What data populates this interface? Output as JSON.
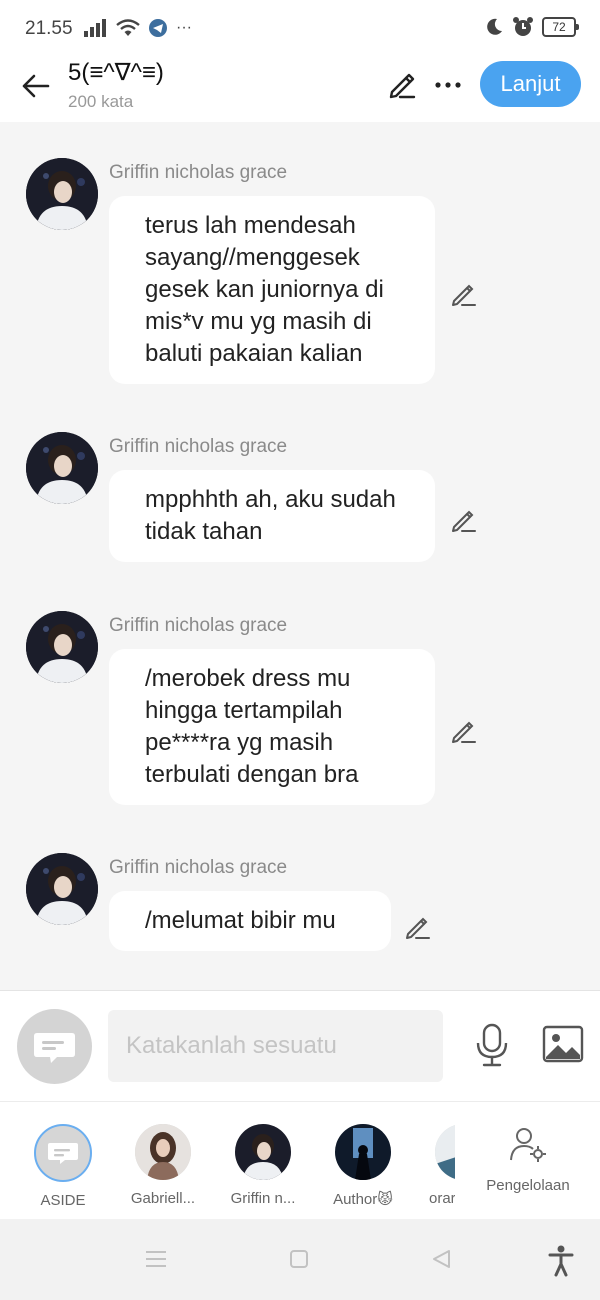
{
  "status_bar": {
    "time": "21.55",
    "ellipsis": "···",
    "battery": "72"
  },
  "header": {
    "title": "5(≡^∇^≡)",
    "word_count": "200 kata",
    "next_button": "Lanjut"
  },
  "messages": [
    {
      "sender": "Griffin nicholas grace",
      "text": "terus lah mendesah sayang//menggesek gesek kan juniornya di mis*v mu yg masih di baluti pakaian kalian"
    },
    {
      "sender": "Griffin nicholas grace",
      "text": "mpphhth ah, aku sudah tidak tahan"
    },
    {
      "sender": "Griffin nicholas grace",
      "text": "/merobek dress mu hingga tertampilah pe****ra yg masih terbulati dengan bra"
    },
    {
      "sender": "Griffin nicholas grace",
      "text": "/melumat bibir mu"
    }
  ],
  "composer": {
    "placeholder": "Katakanlah sesuatu"
  },
  "characters": [
    {
      "label": "ASIDE",
      "selected": true
    },
    {
      "label": "Gabriell..."
    },
    {
      "label": "Griffin n..."
    },
    {
      "label": "Author😾"
    },
    {
      "label": "orar"
    }
  ],
  "manage_label": "Pengelolaan",
  "colors": {
    "accent": "#4aa3f0",
    "background": "#f5f5f5",
    "bubble": "#ffffff",
    "sender_text": "#8a8a8a"
  },
  "icons": {
    "back": "arrow-left-icon",
    "edit": "pencil-icon",
    "more": "more-icon",
    "mic": "microphone-icon",
    "image": "image-icon",
    "manage": "user-gear-icon"
  }
}
